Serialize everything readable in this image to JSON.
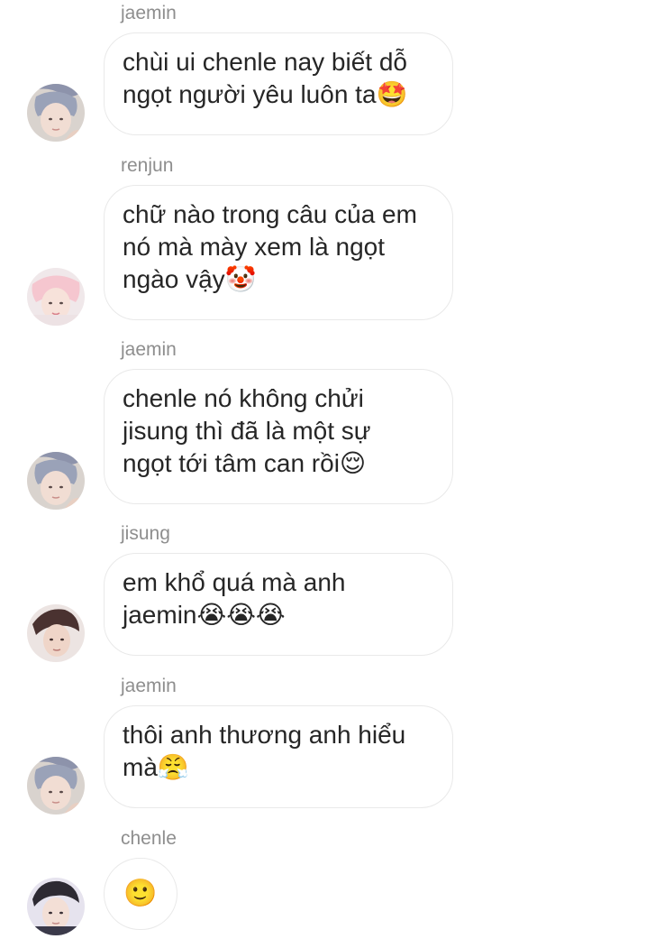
{
  "messages": [
    {
      "sender": "jaemin",
      "text": "chùi ui chenle nay biết dỗ\nngọt người yêu luôn ta🤩",
      "avatar_icon": "jaemin-avatar-icon"
    },
    {
      "sender": "renjun",
      "text": "chữ nào trong câu của em\nnó mà mày xem là ngọt\nngào vậy🤡",
      "avatar_icon": "renjun-avatar-icon"
    },
    {
      "sender": "jaemin",
      "text": "chenle nó không chửi\njisung thì đã là một sự\nngọt tới tâm can rồi😌",
      "avatar_icon": "jaemin-avatar-icon"
    },
    {
      "sender": "jisung",
      "text": "em khổ quá mà anh\njaemin😭😭😭",
      "avatar_icon": "jisung-avatar-icon"
    },
    {
      "sender": "jaemin",
      "text": "thôi anh thương anh hiểu\nmà😤",
      "avatar_icon": "jaemin-avatar-icon"
    },
    {
      "sender": "chenle",
      "text": "🙂",
      "avatar_icon": "chenle-avatar-icon"
    }
  ],
  "colors": {
    "background": "#ffffff",
    "sender_text": "#8e8e8e",
    "message_text": "#262626",
    "bubble_border": "#e9e9e9"
  }
}
